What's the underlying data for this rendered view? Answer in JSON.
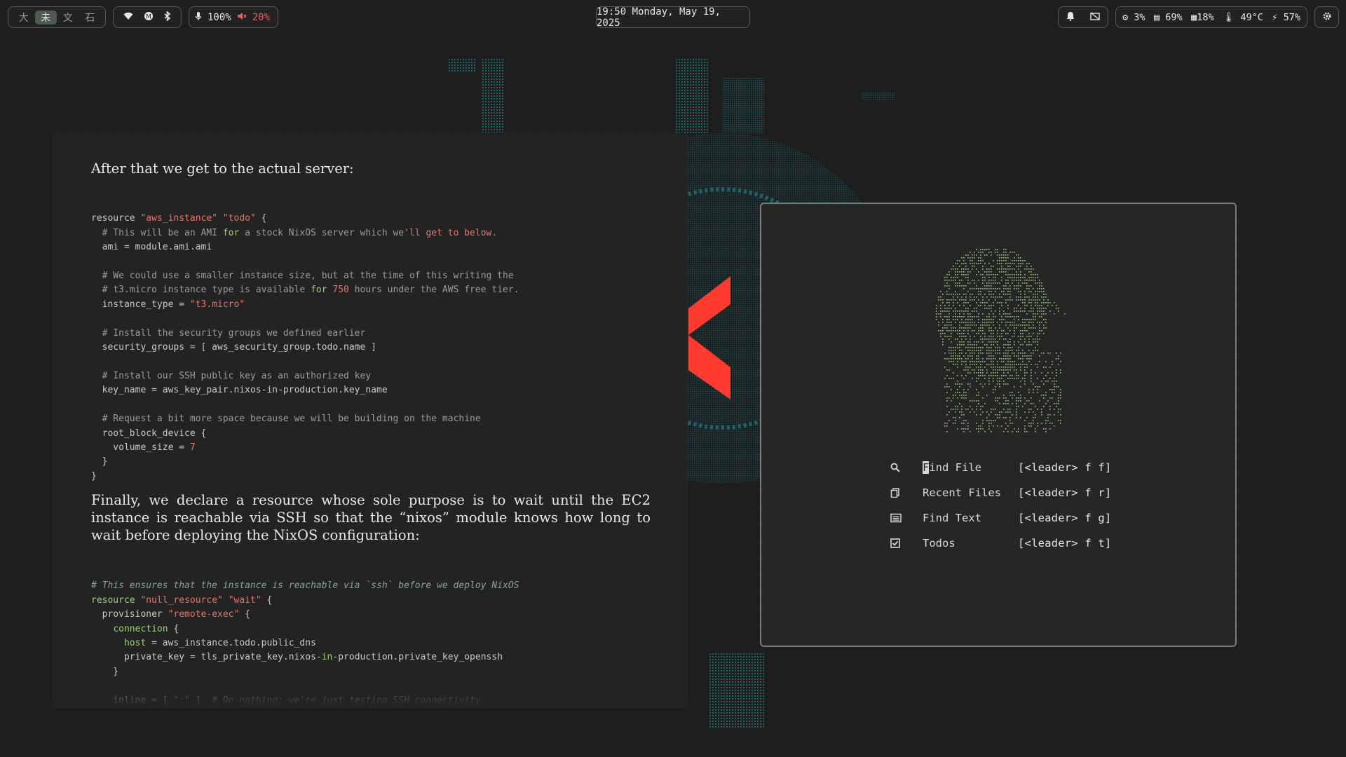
{
  "workspaces": [
    "大",
    "未",
    "文",
    "石"
  ],
  "active_workspace": 1,
  "audio": {
    "mic": "100%",
    "speaker": "20%"
  },
  "clock": "19:50 Monday, May 19, 2025",
  "stats": {
    "cpu": "3%",
    "memory": "69%",
    "disk": "18%",
    "temp": "49°C",
    "battery": "57%"
  },
  "reader": {
    "para1": "After that we get to the actual server:",
    "para2": "Finally, we declare a resource whose sole purpose is to wait until the EC2 instance is reachable via SSH so that the “nixos” module knows how long to wait before deploying the NixOS configuration:",
    "code1": [
      "resource \"aws_instance\" \"todo\" {",
      "  # This will be an AMI for a stock NixOS server which we'll get to below.",
      "  ami = module.ami.ami",
      "",
      "  # We could use a smaller instance size, but at the time of this writing the",
      "  # t3.micro instance type is available for 750 hours under the AWS free tier.",
      "  instance_type = \"t3.micro\"",
      "",
      "  # Install the security groups we defined earlier",
      "  security_groups = [ aws_security_group.todo.name ]",
      "",
      "  # Install our SSH public key as an authorized key",
      "  key_name = aws_key_pair.nixos-in-production.key_name",
      "",
      "  # Request a bit more space because we will be building on the machine",
      "  root_block_device {",
      "    volume_size = 7",
      "  }",
      "}"
    ],
    "code2": [
      "# This ensures that the instance is reachable via `ssh` before we deploy NixOS",
      "resource \"null_resource\" \"wait\" {",
      "  provisioner \"remote-exec\" {",
      "    connection {",
      "      host = aws_instance.todo.public_dns",
      "      private_key = tls_private_key.nixos-in-production.private_key_openssh",
      "    }",
      "",
      "    inline = [ \":\" ]  # Do nothing; we're just testing SSH connectivity"
    ]
  },
  "dashboard": {
    "items": [
      {
        "icon": "search-icon",
        "label": "Find File",
        "key": "[<leader> f f]"
      },
      {
        "icon": "recent-files-icon",
        "label": "Recent Files",
        "key": "[<leader> f r]"
      },
      {
        "icon": "find-text-icon",
        "label": "Find Text",
        "key": "[<leader> f g]"
      },
      {
        "icon": "todo-check-icon",
        "label": "Todos",
        "key": "[<leader> f t]"
      }
    ]
  },
  "colors": {
    "accent_red": "#ff3b30",
    "ascii_green": "#8fd06c",
    "teal": "#1e5e63"
  }
}
